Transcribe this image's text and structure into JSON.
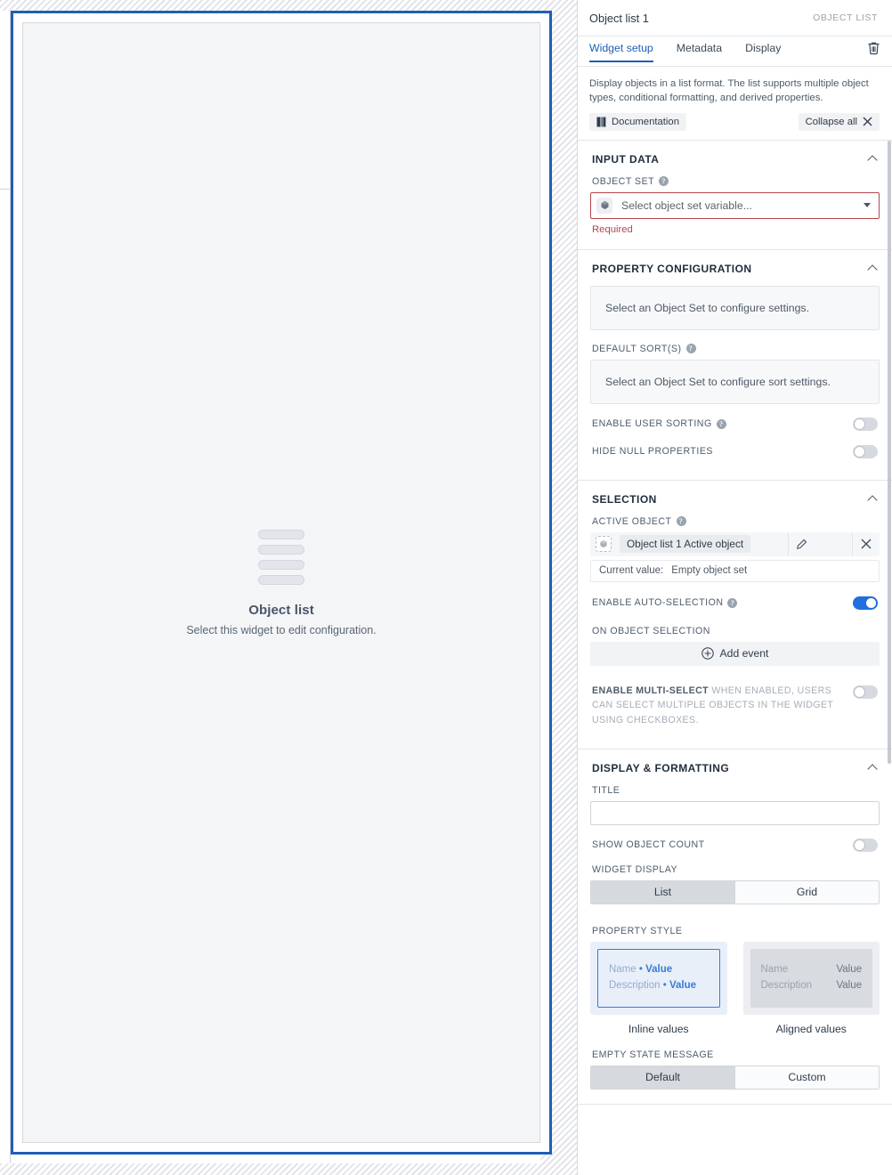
{
  "panel": {
    "title": "Object list 1",
    "kind_label": "OBJECT LIST",
    "tabs": [
      {
        "label": "Widget setup",
        "active": true
      },
      {
        "label": "Metadata",
        "active": false
      },
      {
        "label": "Display",
        "active": false
      }
    ],
    "delete_icon": "trash-icon",
    "description": "Display objects in a list format. The list supports multiple object types, conditional formatting, and derived properties.",
    "documentation_label": "Documentation",
    "documentation_icon": "book-icon",
    "collapse_all_label": "Collapse all",
    "collapse_all_icon": "collapse-icon"
  },
  "canvas": {
    "widget_icon": "list-rows-icon",
    "widget_title": "Object list",
    "widget_subtitle": "Select this widget to edit configuration.",
    "selection_color": "#1f5eb8"
  },
  "sections": {
    "input_data": {
      "title": "INPUT DATA",
      "object_set": {
        "label": "OBJECT SET",
        "help_icon": "help-icon",
        "icon": "cube-icon",
        "placeholder": "Select object set variable...",
        "value": "",
        "error": "Required",
        "error_color": "#b5454b",
        "caret_icon": "caret-down-icon"
      }
    },
    "property_configuration": {
      "title": "PROPERTY CONFIGURATION",
      "properties_empty": "Select an Object Set to configure settings.",
      "default_sorts": {
        "label": "DEFAULT SORT(S)",
        "help_icon": "help-icon",
        "empty": "Select an Object Set to configure sort settings."
      },
      "enable_user_sorting": {
        "label": "ENABLE USER SORTING",
        "help_icon": "help-icon",
        "on": false
      },
      "hide_null_properties": {
        "label": "HIDE NULL PROPERTIES",
        "on": false
      }
    },
    "selection": {
      "title": "SELECTION",
      "active_object": {
        "label": "ACTIVE OBJECT",
        "help_icon": "help-icon",
        "icon": "cube-icon",
        "chip": "Object list 1 Active object",
        "edit_icon": "pencil-icon",
        "clear_icon": "close-icon",
        "current_value_label": "Current value:",
        "current_value": "Empty object set"
      },
      "enable_auto_selection": {
        "label": "ENABLE AUTO-SELECTION",
        "help_icon": "help-icon",
        "on": true
      },
      "on_object_selection": {
        "label": "ON OBJECT SELECTION",
        "add_event_label": "Add event",
        "add_event_icon": "plus-circle-icon"
      },
      "enable_multi_select": {
        "label_strong": "ENABLE MULTI-SELECT",
        "label_rest": "WHEN ENABLED, USERS CAN SELECT MULTIPLE OBJECTS IN THE WIDGET USING CHECKBOXES.",
        "on": false
      }
    },
    "display_formatting": {
      "title": "DISPLAY & FORMATTING",
      "title_field": {
        "label": "TITLE",
        "value": "",
        "placeholder": ""
      },
      "show_object_count": {
        "label": "SHOW OBJECT COUNT",
        "on": false
      },
      "widget_display": {
        "label": "WIDGET DISPLAY",
        "options": [
          "List",
          "Grid"
        ],
        "selected": "List"
      },
      "property_style": {
        "label": "PROPERTY STYLE",
        "selected": "Inline values",
        "cards": [
          {
            "caption": "Inline values",
            "selected": true,
            "rows": [
              {
                "name": "Name",
                "sep": "•",
                "value": "Value"
              },
              {
                "name": "Description",
                "sep": "•",
                "value": "Value"
              }
            ]
          },
          {
            "caption": "Aligned values",
            "selected": false,
            "rows": [
              {
                "name": "Name",
                "value": "Value"
              },
              {
                "name": "Description",
                "value": "Value"
              }
            ]
          }
        ]
      },
      "empty_state_message": {
        "label": "EMPTY STATE MESSAGE",
        "options": [
          "Default",
          "Custom"
        ],
        "selected": "Default"
      }
    }
  }
}
